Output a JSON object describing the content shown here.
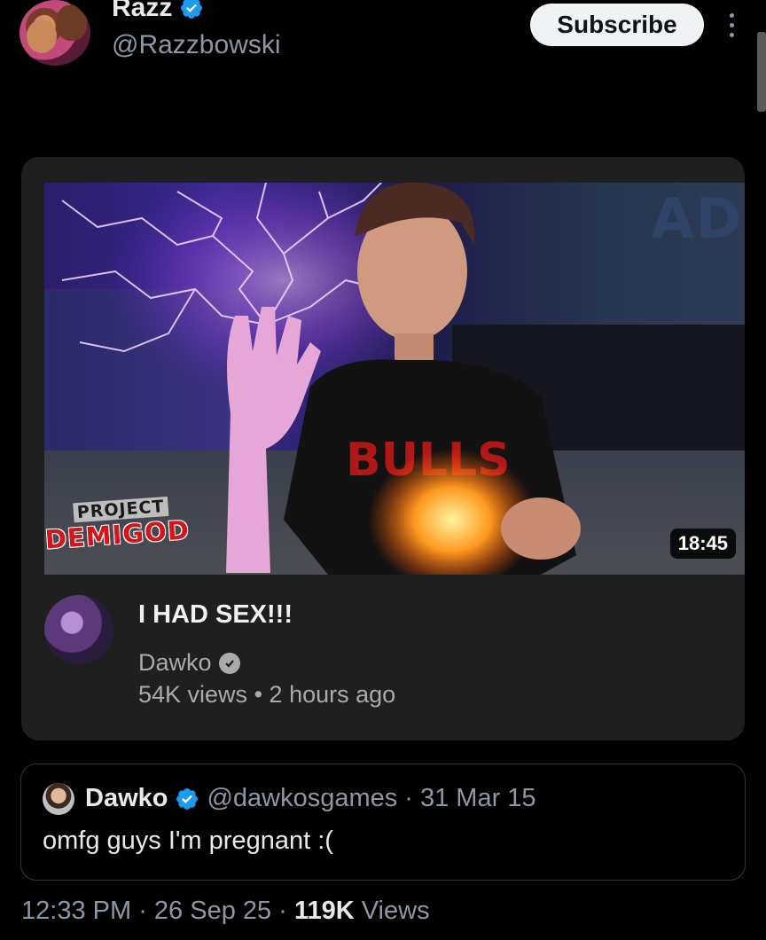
{
  "author": {
    "name": "Razz",
    "handle": "@Razzbowski",
    "verified": true,
    "subscribe_label": "Subscribe"
  },
  "media": {
    "ad_badge": "AD",
    "logo_line1": "PROJECT",
    "logo_line2": "DEMIGOD",
    "shirt_text": "BULLS",
    "duration": "18:45",
    "video_title": "I HAD SEX!!!",
    "channel": "Dawko",
    "views": "54K views",
    "age": "2 hours ago"
  },
  "quote": {
    "name": "Dawko",
    "handle": "@dawkosgames",
    "date": "31 Mar 15",
    "text": "omfg guys I'm pregnant :("
  },
  "footer": {
    "time": "12:33 PM",
    "date": "26 Sep 25",
    "views_count": "119K",
    "views_label": "Views"
  },
  "colors": {
    "verified_blue": "#1d9bf0",
    "background": "#000000",
    "card": "#1f1f1f"
  }
}
